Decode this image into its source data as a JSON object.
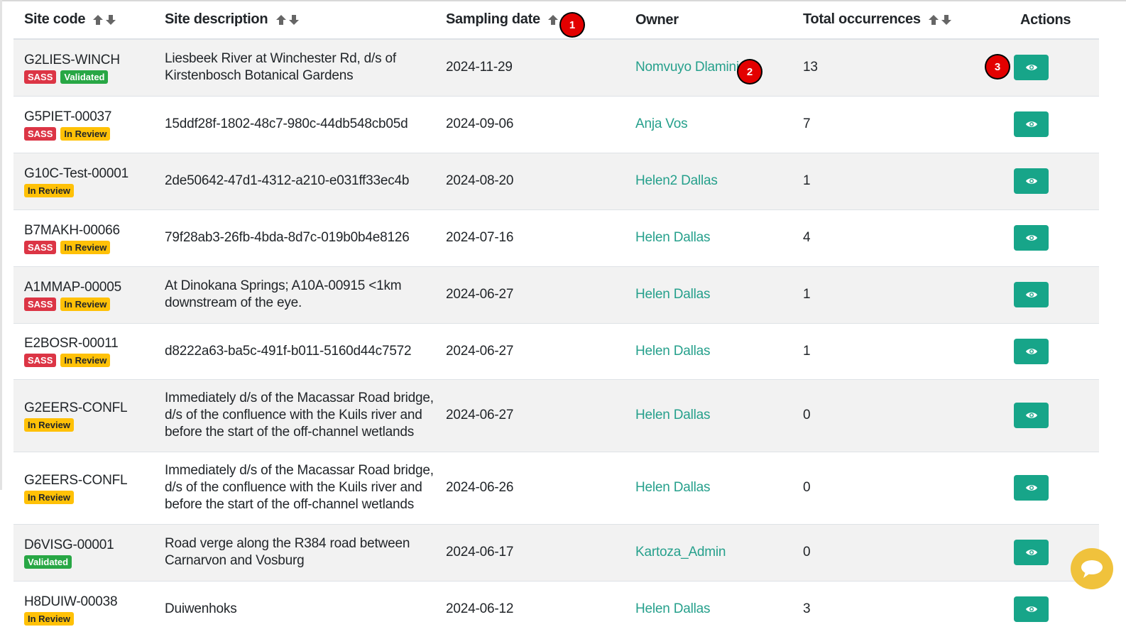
{
  "table": {
    "headers": {
      "site_code": "Site code",
      "site_description": "Site description",
      "sampling_date": "Sampling date",
      "owner": "Owner",
      "total_occurrences": "Total occurrences",
      "actions": "Actions"
    },
    "rows": [
      {
        "site_code": "G2LIES-WINCH",
        "badges": [
          "SASS",
          "Validated"
        ],
        "description": "Liesbeek River at Winchester Rd, d/s of Kirstenbosch Botanical Gardens",
        "date": "2024-11-29",
        "owner": "Nomvuyo Dlamini",
        "occurrences": "13"
      },
      {
        "site_code": "G5PIET-00037",
        "badges": [
          "SASS",
          "In Review"
        ],
        "description": "15ddf28f-1802-48c7-980c-44db548cb05d",
        "date": "2024-09-06",
        "owner": "Anja Vos",
        "occurrences": "7"
      },
      {
        "site_code": "G10C-Test-00001",
        "badges": [
          "In Review"
        ],
        "description": "2de50642-47d1-4312-a210-e031ff33ec4b",
        "date": "2024-08-20",
        "owner": "Helen2 Dallas",
        "occurrences": "1"
      },
      {
        "site_code": "B7MAKH-00066",
        "badges": [
          "SASS",
          "In Review"
        ],
        "description": "79f28ab3-26fb-4bda-8d7c-019b0b4e8126",
        "date": "2024-07-16",
        "owner": "Helen Dallas",
        "occurrences": "4"
      },
      {
        "site_code": "A1MMAP-00005",
        "badges": [
          "SASS",
          "In Review"
        ],
        "description": "At Dinokana Springs; A10A-00915 <1km downstream of the eye.",
        "date": "2024-06-27",
        "owner": "Helen Dallas",
        "occurrences": "1"
      },
      {
        "site_code": "E2BOSR-00011",
        "badges": [
          "SASS",
          "In Review"
        ],
        "description": "d8222a63-ba5c-491f-b011-5160d44c7572",
        "date": "2024-06-27",
        "owner": "Helen Dallas",
        "occurrences": "1"
      },
      {
        "site_code": "G2EERS-CONFL",
        "badges": [
          "In Review"
        ],
        "description": "Immediately d/s of the Macassar Road bridge, d/s of the confluence with the Kuils river and before the start of the off-channel wetlands",
        "date": "2024-06-27",
        "owner": "Helen Dallas",
        "occurrences": "0"
      },
      {
        "site_code": "G2EERS-CONFL",
        "badges": [
          "In Review"
        ],
        "description": "Immediately d/s of the Macassar Road bridge, d/s of the confluence with the Kuils river and before the start of the off-channel wetlands",
        "date": "2024-06-26",
        "owner": "Helen Dallas",
        "occurrences": "0"
      },
      {
        "site_code": "D6VISG-00001",
        "badges": [
          "Validated"
        ],
        "description": "Road verge along the R384 road between Carnarvon and Vosburg",
        "date": "2024-06-17",
        "owner": "Kartoza_Admin",
        "occurrences": "0"
      },
      {
        "site_code": "H8DUIW-00038",
        "badges": [
          "In Review"
        ],
        "description": "Duiwenhoks",
        "date": "2024-06-12",
        "owner": "Helen Dallas",
        "occurrences": "3"
      }
    ]
  },
  "markers": {
    "m1": "1",
    "m2": "2",
    "m3": "3"
  },
  "colors": {
    "owner_link": "#26a08c",
    "view_button": "#17a589",
    "badge_sass": "#dc3545",
    "badge_validated": "#28a745",
    "badge_in_review": "#ffc107",
    "chat_bubble": "#f0c23c"
  },
  "icons": {
    "sort_up": "arrow-up-icon",
    "sort_down": "arrow-down-icon",
    "view": "eye-icon",
    "chat": "chat-icon"
  }
}
